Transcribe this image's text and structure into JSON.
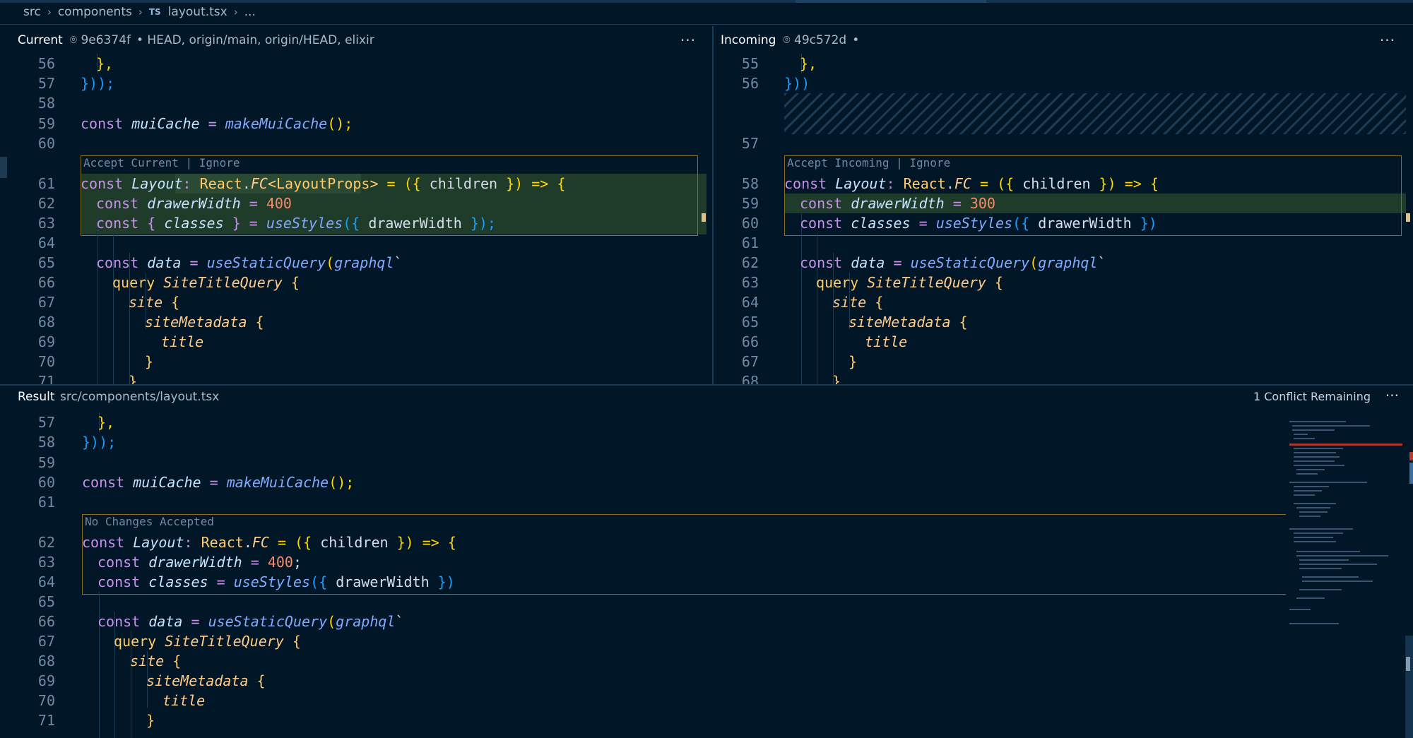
{
  "breadcrumb": {
    "seg1": "src",
    "seg2": "components",
    "ts_badge": "TS",
    "file": "layout.tsx",
    "more": "..."
  },
  "current": {
    "title": "Current",
    "hash": "9e6374f",
    "refs": "• HEAD, origin/main, origin/HEAD, elixir",
    "menu": "···",
    "codelens_accept": "Accept Current",
    "codelens_sep": " | ",
    "codelens_ignore": "Ignore"
  },
  "incoming": {
    "title": "Incoming",
    "hash": "49c572d",
    "refs": "•",
    "menu": "···",
    "codelens_accept": "Accept Incoming",
    "codelens_sep": " | ",
    "codelens_ignore": "Ignore"
  },
  "result": {
    "title": "Result",
    "path": "src/components/layout.tsx",
    "conflicts": "1 Conflict Remaining",
    "menu": "···",
    "codelens": "No Changes Accepted"
  },
  "icons": {
    "commit": "commit-icon",
    "chevron": "chevron-right-icon",
    "more": "ellipsis-icon"
  },
  "current_lines": [
    "56",
    "57",
    "58",
    "59",
    "60",
    "61",
    "62",
    "63",
    "64",
    "65",
    "66",
    "67",
    "68",
    "69",
    "70",
    "71"
  ],
  "incoming_lines": [
    "55",
    "56",
    "57",
    "58",
    "59",
    "60",
    "61",
    "62",
    "63",
    "64",
    "65",
    "66",
    "67",
    "68"
  ],
  "result_lines": [
    "57",
    "58",
    "59",
    "60",
    "61",
    "62",
    "63",
    "64",
    "65",
    "66",
    "67",
    "68",
    "69",
    "70",
    "71"
  ],
  "code": {
    "close_obj": "},",
    "close_call_semicolon": "}));",
    "close_call": "}))",
    "muicache_kw": "const",
    "muicache_var": "muiCache",
    "muicache_eq": " = ",
    "muicache_fn": "makeMuiCache",
    "muicache_tail": "();",
    "layout_kw": "const",
    "layout_var": "Layout",
    "colon": ": ",
    "react": "React",
    "dot": ".",
    "fc": "FC",
    "generic": "<LayoutProps>",
    "arrow_head": " = ({ ",
    "children": "children",
    "arrow_tail": " }) => {",
    "dw_kw": "const",
    "dw_var": "drawerWidth",
    "dw_eq": " = ",
    "dw_current": "400",
    "dw_incoming": "300",
    "dw_result": "400",
    "semi": ";",
    "classes_current_head": "const { ",
    "classes_current_var": "classes",
    "classes_current_mid": " } = ",
    "classes_kw": "const",
    "classes_var": "classes",
    "usestyles": "useStyles",
    "usestyles_args_open": "({ ",
    "usestyles_arg": "drawerWidth",
    "usestyles_args_close_semi": " });",
    "usestyles_args_close": " })",
    "data_kw": "const",
    "data_var": "data",
    "usestatic": "useStaticQuery",
    "graphql_open": "(",
    "graphql": "graphql",
    "backtick": "`",
    "query_kw": "query",
    "query_name": "SiteTitleQuery",
    "open_brace": " {",
    "site": "site",
    "sitemeta": "siteMetadata",
    "title": "title",
    "close_brace": "}"
  }
}
